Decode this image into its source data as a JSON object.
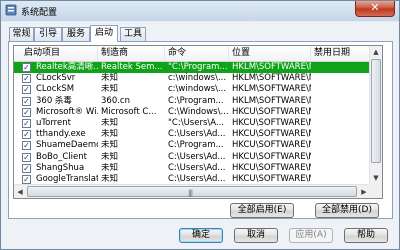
{
  "window": {
    "title": "系统配置",
    "close_glyph": "✕"
  },
  "tabs": [
    {
      "label": "常规",
      "active": false
    },
    {
      "label": "引导",
      "active": false
    },
    {
      "label": "服务",
      "active": false
    },
    {
      "label": "启动",
      "active": true
    },
    {
      "label": "工具",
      "active": false
    }
  ],
  "startup": {
    "columns": [
      "启动项目",
      "制造商",
      "命令",
      "位置",
      "禁用日期"
    ],
    "rows": [
      {
        "checked": true,
        "item": "Realtek高清晰...",
        "maker": "Realtek Sem...",
        "command": "\"C:\\Program...",
        "location": "HKLM\\SOFTWARE\\M...",
        "date": "",
        "selected": true
      },
      {
        "checked": true,
        "item": "CLockSvr",
        "maker": "未知",
        "command": "c:\\windows\\...",
        "location": "HKLM\\SOFTWARE\\M...",
        "date": "",
        "selected": false
      },
      {
        "checked": true,
        "item": "CLockSM",
        "maker": "未知",
        "command": "c:\\windows\\...",
        "location": "HKLM\\SOFTWARE\\M...",
        "date": "",
        "selected": false
      },
      {
        "checked": true,
        "item": "360 杀毒",
        "maker": "360.cn",
        "command": "C:\\Program...",
        "location": "HKLM\\SOFTWARE\\M...",
        "date": "",
        "selected": false
      },
      {
        "checked": true,
        "item": "Microsoft® Wi...",
        "maker": "Microsoft C...",
        "command": "C:\\Windows\\...",
        "location": "HKCU\\SOFTWARE\\M...",
        "date": "",
        "selected": false
      },
      {
        "checked": true,
        "item": "uTorrent",
        "maker": "未知",
        "command": "\"C:\\Users\\A...",
        "location": "HKCU\\SOFTWARE\\M...",
        "date": "",
        "selected": false
      },
      {
        "checked": true,
        "item": "tthandy.exe",
        "maker": "未知",
        "command": "C:\\Users\\Ad...",
        "location": "HKCU\\SOFTWARE\\M...",
        "date": "",
        "selected": false
      },
      {
        "checked": true,
        "item": "ShuameDaemon",
        "maker": "未知",
        "command": "C:\\Program...",
        "location": "HKCU\\SOFTWARE\\M...",
        "date": "",
        "selected": false
      },
      {
        "checked": true,
        "item": "BoBo_Client",
        "maker": "未知",
        "command": "C:\\Users\\Ad...",
        "location": "HKCU\\SOFTWARE\\M...",
        "date": "",
        "selected": false
      },
      {
        "checked": true,
        "item": "ShangShua",
        "maker": "未知",
        "command": "C:\\Users\\Ad...",
        "location": "HKCU\\SOFTWARE\\M...",
        "date": "",
        "selected": false
      },
      {
        "checked": true,
        "item": "GoogleTranslate",
        "maker": "未知",
        "command": "C:\\Users\\Ad...",
        "location": "HKCU\\SOFTWARE\\M...",
        "date": "",
        "selected": false
      }
    ],
    "scroll_arrows": {
      "up": "▲",
      "down": "▼",
      "left": "◀",
      "right": "▶"
    },
    "check_glyph": "✓",
    "grip_glyph": "|||"
  },
  "actions": {
    "enable_all": "全部启用(E)",
    "disable_all": "全部禁用(D)"
  },
  "footer": {
    "ok": "确定",
    "cancel": "取消",
    "apply": "应用(A)",
    "help": "帮助"
  }
}
